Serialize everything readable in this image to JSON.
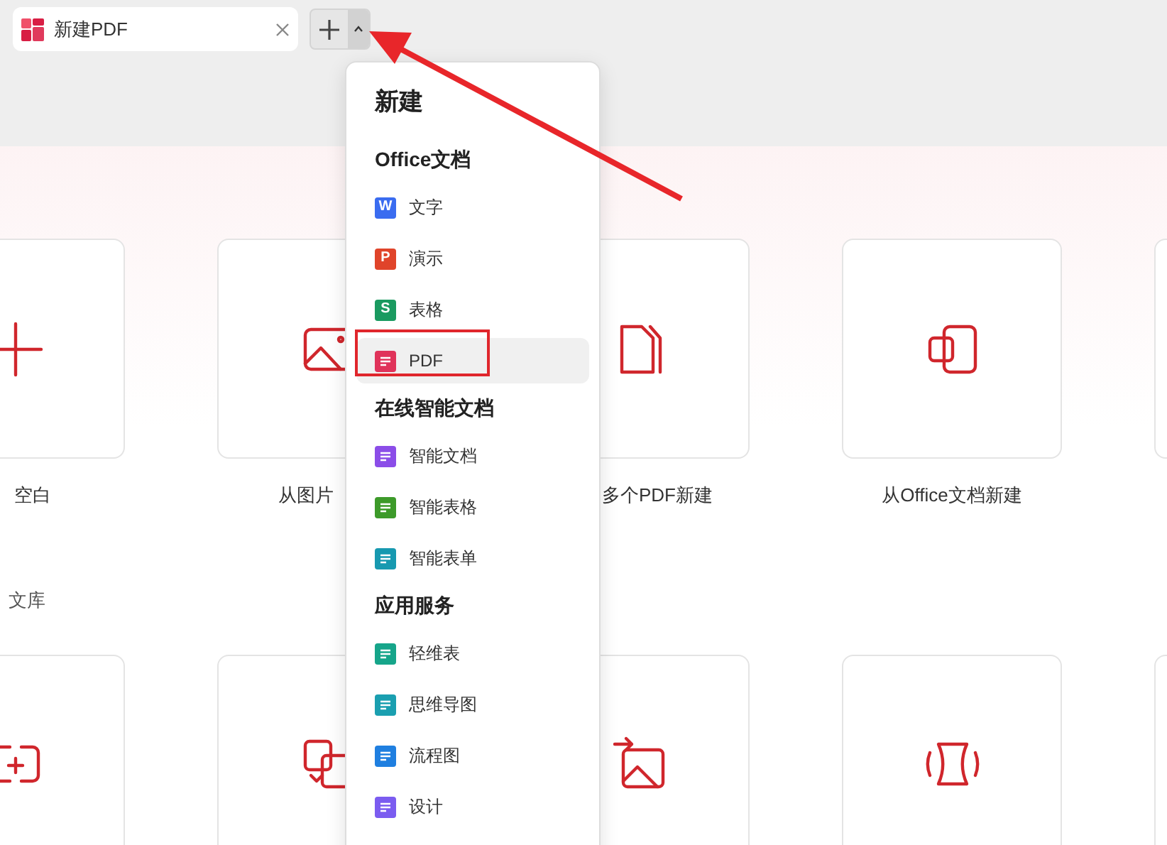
{
  "tab": {
    "title": "新建PDF"
  },
  "cards_row1": [
    {
      "label": "空白"
    },
    {
      "label": "从图片"
    },
    {
      "label": "多个PDF新建"
    },
    {
      "label": "从Office文档新建"
    }
  ],
  "section_label": "文库",
  "menu": {
    "title": "新建",
    "groups": [
      {
        "heading": "Office文档",
        "items": [
          {
            "label": "文字",
            "glyph": "W",
            "color": "#3a6cf0",
            "selected": false
          },
          {
            "label": "演示",
            "glyph": "P",
            "color": "#e0442a",
            "selected": false
          },
          {
            "label": "表格",
            "glyph": "S",
            "color": "#1a9a60",
            "selected": false
          },
          {
            "label": "PDF",
            "color": "#e0335a",
            "selected": true
          }
        ]
      },
      {
        "heading": "在线智能文档",
        "items": [
          {
            "label": "智能文档",
            "color": "#8b4de8",
            "selected": false
          },
          {
            "label": "智能表格",
            "color": "#3d9a2a",
            "selected": false
          },
          {
            "label": "智能表单",
            "color": "#1799b0",
            "selected": false
          }
        ]
      },
      {
        "heading": "应用服务",
        "items": [
          {
            "label": "轻维表",
            "color": "#16a58a",
            "selected": false
          },
          {
            "label": "思维导图",
            "color": "#1a9fb0",
            "selected": false
          },
          {
            "label": "流程图",
            "color": "#1f7fe0",
            "selected": false
          },
          {
            "label": "设计",
            "color": "#7b5cf0",
            "selected": false
          }
        ]
      }
    ]
  }
}
